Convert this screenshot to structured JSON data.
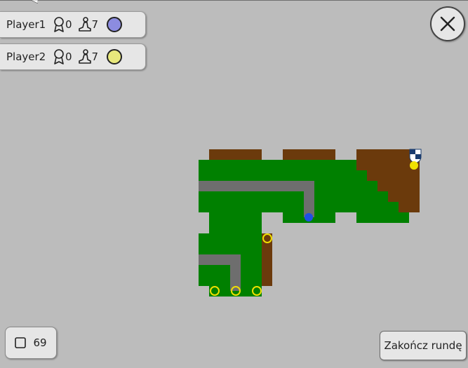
{
  "players": [
    {
      "name": "Player1",
      "points": "0",
      "meeples": "7",
      "color": "#8c8ce0"
    },
    {
      "name": "Player2",
      "points": "0",
      "meeples": "7",
      "color": "#e8e87c"
    }
  ],
  "icons": {
    "points": "ribbon-icon",
    "meeples": "meeple-icon",
    "close": "close-icon",
    "tiles": "tile-square-icon",
    "shield": "shield-icon"
  },
  "tiles_remaining": "69",
  "end_turn_label": "Zakończ rundę",
  "colors": {
    "background": "#bcbcbc",
    "grass": "#008000",
    "city": "#6b3a0c",
    "road": "#6e6e6e",
    "blue_meeple": "#1e50e6",
    "yellow_meeple": "#f0e000"
  }
}
